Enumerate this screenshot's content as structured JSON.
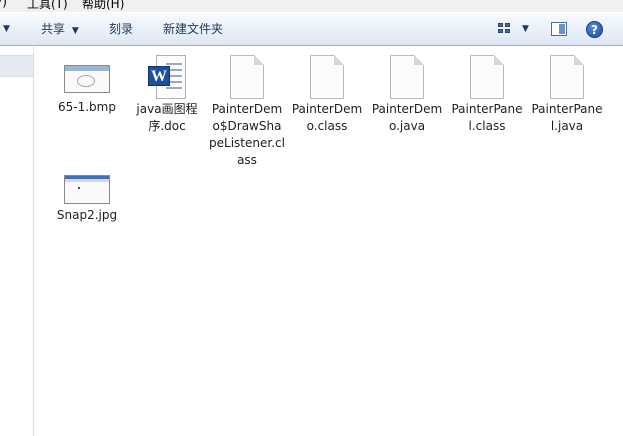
{
  "menubar": {
    "items": [
      "V)",
      "工具(T)",
      "帮助(H)"
    ]
  },
  "toolbar": {
    "organize_arrow": "▼",
    "share_label": "共享",
    "share_arrow": "▼",
    "burn_label": "刻录",
    "new_folder_label": "新建文件夹",
    "view_arrow": "▼",
    "help_icon_glyph": "?",
    "icons": [
      "view-options-icon",
      "preview-pane-icon",
      "help-icon"
    ]
  },
  "files": [
    {
      "name": "65-1.bmp",
      "icon": "bmp-thumbnail-icon"
    },
    {
      "name": "java画图程序.doc",
      "icon": "word-document-icon",
      "badge": "W"
    },
    {
      "name": "PainterDemo$DrawShapeListener.class",
      "icon": "generic-file-icon"
    },
    {
      "name": "PainterDemo.class",
      "icon": "generic-file-icon"
    },
    {
      "name": "PainterDemo.java",
      "icon": "generic-file-icon"
    },
    {
      "name": "PainterPanel.class",
      "icon": "generic-file-icon"
    },
    {
      "name": "PainterPanel.java",
      "icon": "generic-file-icon"
    },
    {
      "name": "Snap2.jpg",
      "icon": "jpg-thumbnail-icon"
    }
  ],
  "colors": {
    "toolbar_text": "#1e395b",
    "toolbar_border": "#a0b1c6",
    "word_badge": "#1e4f9c"
  }
}
